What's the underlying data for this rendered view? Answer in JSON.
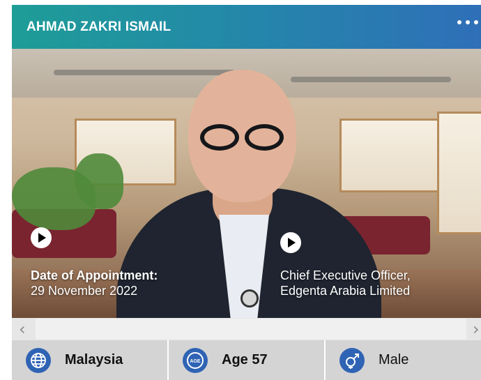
{
  "profile": {
    "name": "AHMAD ZAKRI ISMAIL",
    "appointment_label": "Date of Appointment:",
    "appointment_date": "29 November 2022",
    "role_line1": "Chief Executive Officer,",
    "role_line2": "Edgenta Arabia Limited"
  },
  "stats": {
    "nationality": "Malaysia",
    "age": "Age 57",
    "gender": "Male",
    "age_icon_text": "AGE"
  },
  "scroll": {
    "left_arrow": "‹",
    "right_arrow": "›"
  },
  "icons": {
    "header_menu": "more-dots-icon",
    "play": "play-icon",
    "globe": "globe-icon",
    "age": "age-icon",
    "gender": "gender-icon"
  },
  "colors": {
    "header_start": "#1e9d97",
    "header_end": "#2f6fb8",
    "icon_blue": "#2f63b4",
    "stat_bg": "#d4d4d4"
  }
}
